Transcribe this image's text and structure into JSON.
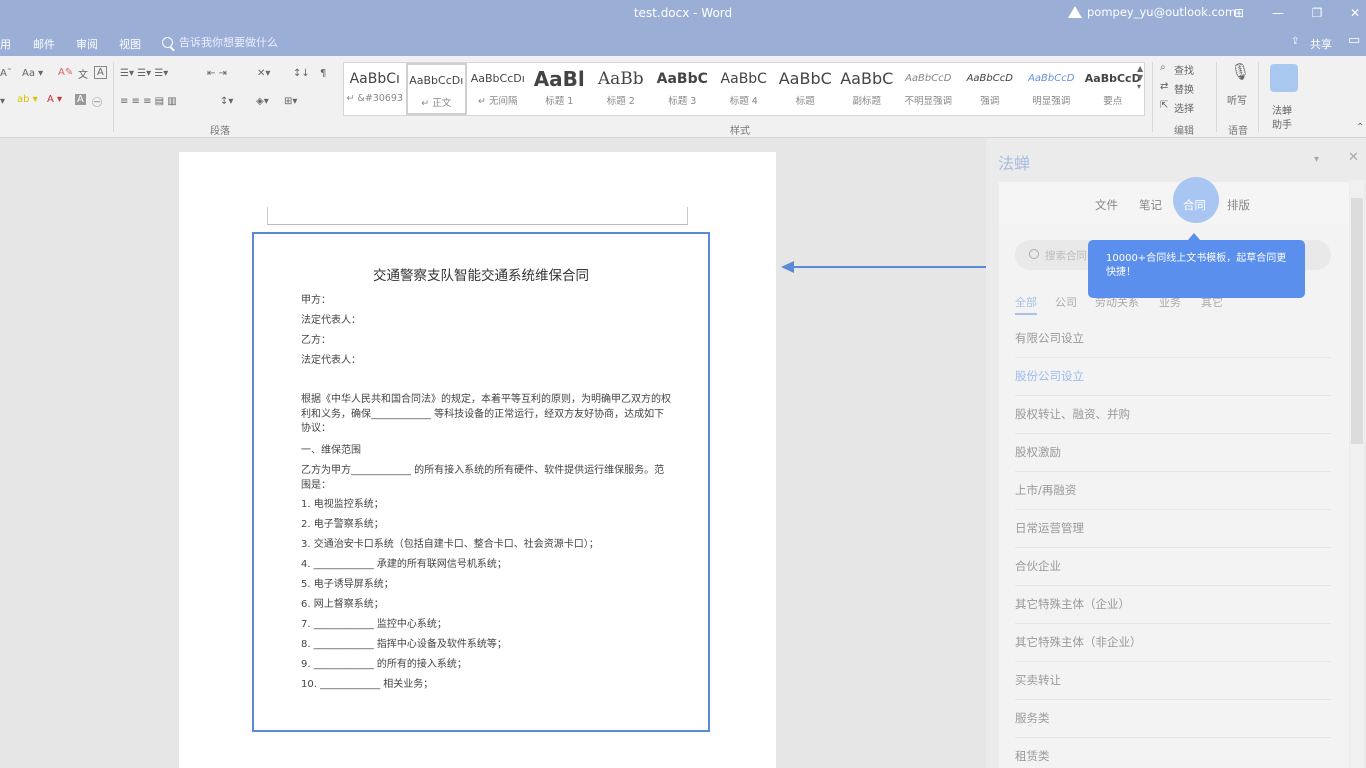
{
  "titlebar": {
    "title": "test.docx  -  Word",
    "account": "pompey_yu@outlook.com",
    "controls": [
      "⊞",
      "—",
      "❐",
      "✕"
    ]
  },
  "menu": {
    "items": [
      "用",
      "邮件",
      "审阅",
      "视图"
    ],
    "tell_me": "告诉我你想要做什么",
    "share": "共享"
  },
  "ribbon": {
    "paragraph_label": "段落",
    "styles_label": "样式",
    "edit_label": "编辑",
    "voice_label": "语音",
    "find": "查找",
    "replace": "替换",
    "select": "选择",
    "dictate": "听写",
    "fachan_line1": "法蝉",
    "fachan_line2": "助手",
    "styles": [
      {
        "sample": "AaBbCı",
        "name": "↵ &#30693"
      },
      {
        "sample": "AaBbCcDı",
        "name": "↵ 正文"
      },
      {
        "sample": "AaBbCcDı",
        "name": "↵ 无间隔"
      },
      {
        "sample": "AaBl",
        "name": "标题 1"
      },
      {
        "sample": "AaBb",
        "name": "标题 2"
      },
      {
        "sample": "AaBbC",
        "name": "标题 3"
      },
      {
        "sample": "AaBbC",
        "name": "标题 4"
      },
      {
        "sample": "AaBbC",
        "name": "标题"
      },
      {
        "sample": "AaBbC",
        "name": "副标题"
      },
      {
        "sample": "AaBbCcD",
        "name": "不明显强调"
      },
      {
        "sample": "AaBbCcD",
        "name": "强调"
      },
      {
        "sample": "AaBbCcD",
        "name": "明显强调"
      },
      {
        "sample": "AaBbCcD",
        "name": "要点"
      }
    ]
  },
  "document": {
    "title": "交通警察支队智能交通系统维保合同",
    "lines": [
      "甲方：",
      "法定代表人：",
      "乙方：",
      "法定代表人：",
      "根据《中华人民共和国合同法》的规定，本着平等互利的原则，为明确甲乙双方的权利和义务，确保____________ 等科技设备的正常运行，经双方友好协商，达成如下协议：",
      "一、维保范围",
      "乙方为甲方____________ 的所有接入系统的所有硬件、软件提供运行维保服务。范围是：",
      "1. 电视监控系统；",
      "2. 电子警察系统；",
      "3. 交通治安卡口系统（包括自建卡口、整合卡口、社会资源卡口）；",
      "4. ____________ 承建的所有联网信号机系统；",
      "5. 电子诱导屏系统；",
      "6. 网上督察系统；",
      "7. ____________ 监控中心系统；",
      "8. ____________ 指挥中心设备及软件系统等；",
      "9. ____________ 的所有的接入系统；",
      "10. ____________ 相关业务；"
    ]
  },
  "pane": {
    "title": "法蝉",
    "tabs": [
      "文件",
      "笔记",
      "合同",
      "排版"
    ],
    "active_tab": "合同",
    "search_placeholder": "搜索合同",
    "categories": [
      "全部",
      "公司",
      "劳动关系",
      "业务",
      "其它"
    ],
    "items": [
      "有限公司设立",
      "股份公司设立",
      "股权转让、融资、并购",
      "股权激励",
      "上市/再融资",
      "日常运营管理",
      "合伙企业",
      "其它特殊主体（企业）",
      "其它特殊主体（非企业）",
      "买卖转让",
      "服务类",
      "租赁类"
    ],
    "highlight_index": 1,
    "tooltip": "10000+合同线上文书模板，起草合同更快捷！",
    "colors": {
      "accent": "#5b8fee",
      "tab_circle": "#a9c6f2",
      "box": "#5b8ad6"
    }
  }
}
